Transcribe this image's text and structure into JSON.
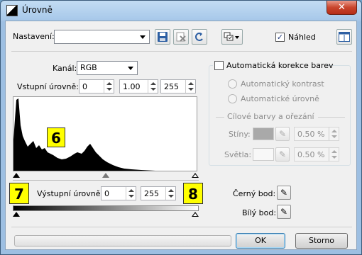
{
  "window": {
    "title": "Úrovně",
    "close_symbol": "✕"
  },
  "preset": {
    "label": "Nastavení:",
    "value": ""
  },
  "toolbar": {
    "save_icon": "save-icon",
    "delete_icon": "delete-icon",
    "reset_icon": "reset-icon",
    "options_icon": "options-icon",
    "layout_icon": "layout-icon"
  },
  "preview": {
    "label": "Náhled",
    "checked": "✓"
  },
  "channel": {
    "label": "Kanál:",
    "value": "RGB"
  },
  "input_levels": {
    "label": "Vstupní úrovně:",
    "black": "0",
    "gamma": "1.00",
    "white": "255"
  },
  "output_levels": {
    "label": "Výstupní úrovně:",
    "black": "0",
    "white": "255"
  },
  "badges": {
    "histogram": "6",
    "output_left": "7",
    "output_right": "8"
  },
  "auto": {
    "label": "Automatická korekce barev",
    "contrast": "Automatický kontrast",
    "levels": "Automatické úrovně"
  },
  "targets": {
    "title": "Cílové barvy a ořezání",
    "shadows_label": "Stíny:",
    "shadows_value": "0.50 %",
    "highlights_label": "Světla:",
    "highlights_value": "0.50 %"
  },
  "black_point": {
    "label": "Černý bod:"
  },
  "white_point": {
    "label": "Bílý bod:"
  },
  "buttons": {
    "ok": "OK",
    "cancel": "Storno"
  }
}
